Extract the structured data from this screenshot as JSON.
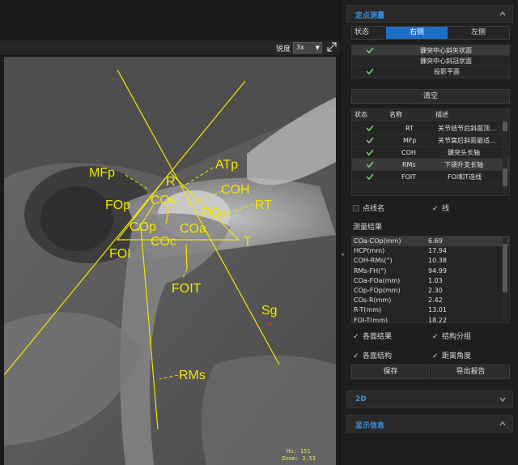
{
  "viewer": {
    "sharpness_label": "锐度",
    "sharpness_value": "3x",
    "hu_readout": "Hu: 151",
    "zoom_readout": "Zoom: 3.53",
    "landmarks": [
      "MFp",
      "R",
      "ATp",
      "FOp",
      "COs",
      "COH",
      "RT",
      "COp",
      "FOa",
      "COa",
      "T",
      "FOI",
      "COc",
      "FOIT",
      "Sg",
      "RMs"
    ],
    "overlay_color": "#f2e600"
  },
  "panel": {
    "point_measure": {
      "title": "定点测量",
      "side_label": "状态",
      "tabs": [
        "右侧",
        "左侧"
      ],
      "active_tab": "右侧",
      "planes": [
        {
          "checked": true,
          "label": "髁突中心斜矢状面",
          "selected": true
        },
        {
          "checked": false,
          "label": "髁突中心斜冠状面",
          "selected": false
        },
        {
          "checked": true,
          "label": "投影平面",
          "selected": false
        }
      ],
      "clear_button": "清空",
      "struct_headers": [
        "状态",
        "名称",
        "描述"
      ],
      "structures": [
        {
          "checked": true,
          "name": "RT",
          "desc": "关节结节后斜面顶...",
          "selected": false
        },
        {
          "checked": true,
          "name": "MFp",
          "desc": "关节窝后斜面最适...",
          "selected": false
        },
        {
          "checked": true,
          "name": "COH",
          "desc": "髁突头长轴",
          "selected": false
        },
        {
          "checked": true,
          "name": "RMs",
          "desc": "下颌升支长轴",
          "selected": true
        },
        {
          "checked": true,
          "name": "FOIT",
          "desc": "FOI和T连线",
          "selected": false
        }
      ],
      "show_point_name_label": "点线名",
      "show_point_name": false,
      "line_label": "线",
      "line_checked": true,
      "results_title": "测量结果",
      "results": [
        {
          "name": "COa-COp(mm)",
          "value": "6.69"
        },
        {
          "name": "HCP(mm)",
          "value": "17.94"
        },
        {
          "name": "COH-RMs(°)",
          "value": "10.38"
        },
        {
          "name": "RMs-FH(°)",
          "value": "94.99"
        },
        {
          "name": "COa-FOa(mm)",
          "value": "1.03"
        },
        {
          "name": "COp-FOp(mm)",
          "value": "2.30"
        },
        {
          "name": "COs-R(mm)",
          "value": "2.42"
        },
        {
          "name": "R-T(mm)",
          "value": "13.01"
        },
        {
          "name": "FOI-T(mm)",
          "value": "18.22"
        }
      ],
      "options": [
        {
          "label": "各面结果",
          "checked": true
        },
        {
          "label": "结构分组",
          "checked": true
        },
        {
          "label": "各面结构",
          "checked": true
        },
        {
          "label": "距离角度",
          "checked": true
        }
      ],
      "save_button": "保存",
      "export_button": "导出报告"
    },
    "section_2d": "2D",
    "section_display": "显示信息"
  }
}
